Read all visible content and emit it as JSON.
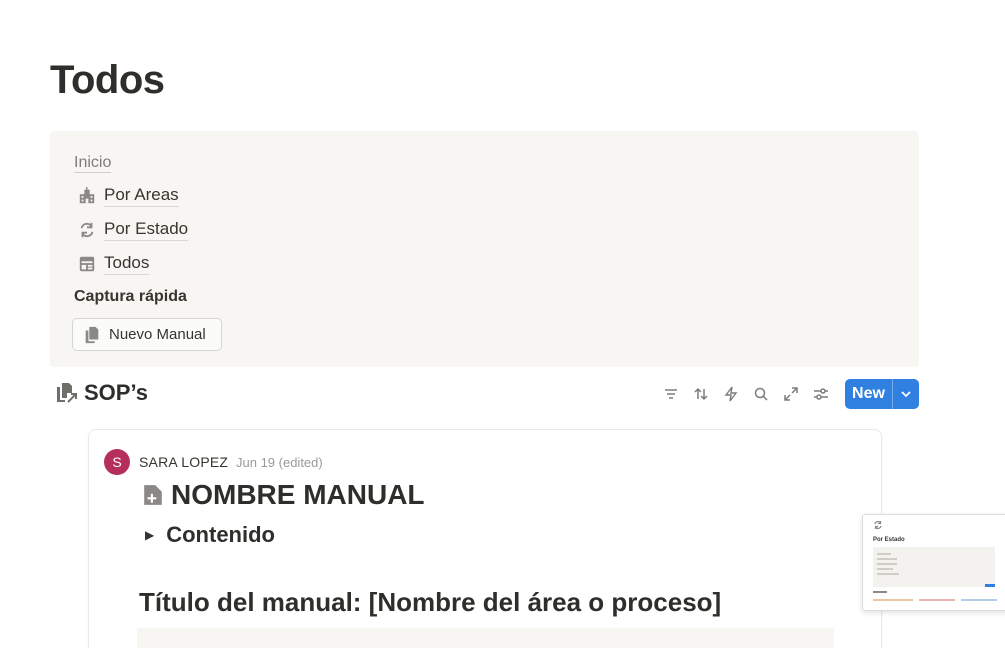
{
  "page": {
    "title": "Todos"
  },
  "callout": {
    "inicio_label": "Inicio",
    "links": [
      {
        "label": "Por Areas",
        "icon": "school-building-icon"
      },
      {
        "label": "Por Estado",
        "icon": "refresh-arrows-icon"
      },
      {
        "label": "Todos",
        "icon": "calendar-table-icon"
      }
    ],
    "quick_capture_label": "Captura rápida",
    "new_manual_button": "Nuevo Manual"
  },
  "database": {
    "title": "SOP’s",
    "new_button": "New",
    "toolbar_icons": [
      "filter-icon",
      "sort-icon",
      "automation-bolt-icon",
      "search-icon",
      "expand-icon",
      "settings-sliders-icon"
    ]
  },
  "card": {
    "avatar_initial": "S",
    "author": "SARA LOPEZ",
    "date": "Jun 19 (edited)",
    "doc_title": "NOMBRE MANUAL",
    "toggle_label": "Contenido",
    "heading": "Título del manual: [Nombre del área o proceso]"
  },
  "thumbnail": {
    "title": "Por Estado"
  },
  "colors": {
    "accent": "#2f80e1",
    "avatar": "#b62e5b",
    "callout_bg": "#f7f6f3"
  }
}
